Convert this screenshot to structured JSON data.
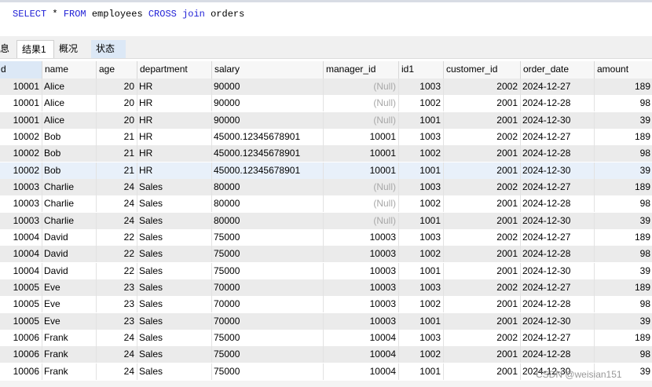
{
  "editor": {
    "sql": [
      {
        "t": "SELECT",
        "k": true
      },
      {
        "t": " * ",
        "k": false
      },
      {
        "t": "FROM",
        "k": true
      },
      {
        "t": " employees ",
        "k": false
      },
      {
        "t": "CROSS",
        "k": true
      },
      {
        "t": " ",
        "k": false
      },
      {
        "t": "join",
        "k": true
      },
      {
        "t": " orders",
        "k": false
      }
    ]
  },
  "tabs": {
    "info": "息",
    "result": "结果1",
    "profile": "概况",
    "status": "状态"
  },
  "columns": [
    "d",
    "name",
    "age",
    "department",
    "salary",
    "manager_id",
    "id1",
    "customer_id",
    "order_date",
    "amount"
  ],
  "null_label": "(Null)",
  "rows": [
    [
      "10001",
      "Alice",
      "20",
      "HR",
      "90000",
      null,
      "1003",
      "2002",
      "2024-12-27",
      "189"
    ],
    [
      "10001",
      "Alice",
      "20",
      "HR",
      "90000",
      null,
      "1002",
      "2001",
      "2024-12-28",
      "98"
    ],
    [
      "10001",
      "Alice",
      "20",
      "HR",
      "90000",
      null,
      "1001",
      "2001",
      "2024-12-30",
      "39"
    ],
    [
      "10002",
      "Bob",
      "21",
      "HR",
      "45000.12345678901",
      "10001",
      "1003",
      "2002",
      "2024-12-27",
      "189"
    ],
    [
      "10002",
      "Bob",
      "21",
      "HR",
      "45000.12345678901",
      "10001",
      "1002",
      "2001",
      "2024-12-28",
      "98"
    ],
    [
      "10002",
      "Bob",
      "21",
      "HR",
      "45000.12345678901",
      "10001",
      "1001",
      "2001",
      "2024-12-30",
      "39"
    ],
    [
      "10003",
      "Charlie",
      "24",
      "Sales",
      "80000",
      null,
      "1003",
      "2002",
      "2024-12-27",
      "189"
    ],
    [
      "10003",
      "Charlie",
      "24",
      "Sales",
      "80000",
      null,
      "1002",
      "2001",
      "2024-12-28",
      "98"
    ],
    [
      "10003",
      "Charlie",
      "24",
      "Sales",
      "80000",
      null,
      "1001",
      "2001",
      "2024-12-30",
      "39"
    ],
    [
      "10004",
      "David",
      "22",
      "Sales",
      "75000",
      "10003",
      "1003",
      "2002",
      "2024-12-27",
      "189"
    ],
    [
      "10004",
      "David",
      "22",
      "Sales",
      "75000",
      "10003",
      "1002",
      "2001",
      "2024-12-28",
      "98"
    ],
    [
      "10004",
      "David",
      "22",
      "Sales",
      "75000",
      "10003",
      "1001",
      "2001",
      "2024-12-30",
      "39"
    ],
    [
      "10005",
      "Eve",
      "23",
      "Sales",
      "70000",
      "10003",
      "1003",
      "2002",
      "2024-12-27",
      "189"
    ],
    [
      "10005",
      "Eve",
      "23",
      "Sales",
      "70000",
      "10003",
      "1002",
      "2001",
      "2024-12-28",
      "98"
    ],
    [
      "10005",
      "Eve",
      "23",
      "Sales",
      "70000",
      "10003",
      "1001",
      "2001",
      "2024-12-30",
      "39"
    ],
    [
      "10006",
      "Frank",
      "24",
      "Sales",
      "75000",
      "10004",
      "1003",
      "2002",
      "2024-12-27",
      "189"
    ],
    [
      "10006",
      "Frank",
      "24",
      "Sales",
      "75000",
      "10004",
      "1002",
      "2001",
      "2024-12-28",
      "98"
    ],
    [
      "10006",
      "Frank",
      "24",
      "Sales",
      "75000",
      "10004",
      "1001",
      "2001",
      "2024-12-30",
      "39"
    ]
  ],
  "selected_row_index": 5,
  "watermark": "CSDN @weisian151"
}
